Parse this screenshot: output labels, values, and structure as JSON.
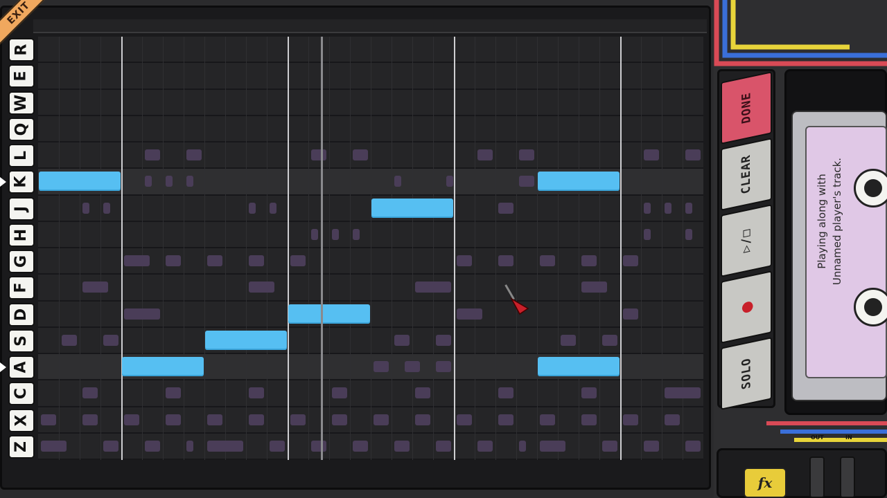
{
  "exit_label": "EXIT",
  "keys": [
    "R",
    "E",
    "W",
    "Q",
    "L",
    "K",
    "J",
    "H",
    "G",
    "F",
    "D",
    "S",
    "A",
    "C",
    "X",
    "Z"
  ],
  "highlighted_rows": [
    5,
    12
  ],
  "grid": {
    "rows": 16,
    "bar_lines": [
      2,
      6,
      10,
      14,
      18
    ],
    "playhead_col": 6.8,
    "notes": [
      {
        "row": 5,
        "start": 0,
        "len": 2
      },
      {
        "row": 12,
        "start": 2,
        "len": 2
      },
      {
        "row": 11,
        "start": 4,
        "len": 2
      },
      {
        "row": 10,
        "start": 6,
        "len": 2
      },
      {
        "row": 6,
        "start": 8,
        "len": 2
      },
      {
        "row": 5,
        "start": 12,
        "len": 2
      },
      {
        "row": 12,
        "start": 12,
        "len": 2
      }
    ],
    "ghost_notes": [
      {
        "row": 4,
        "start": 2.5,
        "len": 0.5
      },
      {
        "row": 4,
        "start": 3.5,
        "len": 0.5
      },
      {
        "row": 4,
        "start": 6.5,
        "len": 0.5
      },
      {
        "row": 4,
        "start": 7.5,
        "len": 0.5
      },
      {
        "row": 4,
        "start": 10.5,
        "len": 0.5
      },
      {
        "row": 4,
        "start": 11.5,
        "len": 0.5
      },
      {
        "row": 4,
        "start": 14.5,
        "len": 0.5
      },
      {
        "row": 4,
        "start": 15.5,
        "len": 0.5
      },
      {
        "row": 5,
        "start": 2.5,
        "len": 0.25
      },
      {
        "row": 5,
        "start": 3,
        "len": 0.25
      },
      {
        "row": 5,
        "start": 3.5,
        "len": 0.25
      },
      {
        "row": 5,
        "start": 8.5,
        "len": 0.25
      },
      {
        "row": 5,
        "start": 9.75,
        "len": 0.25
      },
      {
        "row": 5,
        "start": 11.5,
        "len": 0.5
      },
      {
        "row": 6,
        "start": 1,
        "len": 0.25
      },
      {
        "row": 6,
        "start": 1.5,
        "len": 0.25
      },
      {
        "row": 6,
        "start": 5,
        "len": 0.25
      },
      {
        "row": 6,
        "start": 5.5,
        "len": 0.25
      },
      {
        "row": 6,
        "start": 11,
        "len": 0.5
      },
      {
        "row": 6,
        "start": 14.5,
        "len": 0.25
      },
      {
        "row": 6,
        "start": 15,
        "len": 0.25
      },
      {
        "row": 6,
        "start": 15.5,
        "len": 0.25
      },
      {
        "row": 7,
        "start": 6.5,
        "len": 0.25
      },
      {
        "row": 7,
        "start": 7,
        "len": 0.25
      },
      {
        "row": 7,
        "start": 7.5,
        "len": 0.25
      },
      {
        "row": 7,
        "start": 14.5,
        "len": 0.25
      },
      {
        "row": 7,
        "start": 15.5,
        "len": 0.25
      },
      {
        "row": 8,
        "start": 2,
        "len": 0.75
      },
      {
        "row": 8,
        "start": 3,
        "len": 0.5
      },
      {
        "row": 8,
        "start": 4,
        "len": 0.5
      },
      {
        "row": 8,
        "start": 5,
        "len": 0.5
      },
      {
        "row": 8,
        "start": 6,
        "len": 0.5
      },
      {
        "row": 8,
        "start": 10,
        "len": 0.5
      },
      {
        "row": 8,
        "start": 11,
        "len": 0.5
      },
      {
        "row": 8,
        "start": 12,
        "len": 0.5
      },
      {
        "row": 8,
        "start": 13,
        "len": 0.5
      },
      {
        "row": 8,
        "start": 14,
        "len": 0.5
      },
      {
        "row": 9,
        "start": 1,
        "len": 0.75
      },
      {
        "row": 9,
        "start": 5,
        "len": 0.75
      },
      {
        "row": 9,
        "start": 9,
        "len": 1
      },
      {
        "row": 9,
        "start": 13,
        "len": 0.75
      },
      {
        "row": 10,
        "start": 2,
        "len": 1
      },
      {
        "row": 10,
        "start": 10,
        "len": 0.75
      },
      {
        "row": 10,
        "start": 14,
        "len": 0.5
      },
      {
        "row": 11,
        "start": 0.5,
        "len": 0.5
      },
      {
        "row": 11,
        "start": 1.5,
        "len": 0.5
      },
      {
        "row": 11,
        "start": 8.5,
        "len": 0.5
      },
      {
        "row": 11,
        "start": 9.5,
        "len": 0.5
      },
      {
        "row": 11,
        "start": 12.5,
        "len": 0.5
      },
      {
        "row": 11,
        "start": 13.5,
        "len": 0.5
      },
      {
        "row": 12,
        "start": 8,
        "len": 0.5
      },
      {
        "row": 12,
        "start": 8.75,
        "len": 0.5
      },
      {
        "row": 12,
        "start": 9.5,
        "len": 0.5
      },
      {
        "row": 13,
        "start": 1,
        "len": 0.5
      },
      {
        "row": 13,
        "start": 3,
        "len": 0.5
      },
      {
        "row": 13,
        "start": 5,
        "len": 0.5
      },
      {
        "row": 13,
        "start": 7,
        "len": 0.5
      },
      {
        "row": 13,
        "start": 9,
        "len": 0.5
      },
      {
        "row": 13,
        "start": 11,
        "len": 0.5
      },
      {
        "row": 13,
        "start": 13,
        "len": 0.5
      },
      {
        "row": 13,
        "start": 15,
        "len": 1
      },
      {
        "row": 14,
        "start": 0,
        "len": 0.5
      },
      {
        "row": 14,
        "start": 1,
        "len": 0.5
      },
      {
        "row": 14,
        "start": 2,
        "len": 0.5
      },
      {
        "row": 14,
        "start": 3,
        "len": 0.5
      },
      {
        "row": 14,
        "start": 4,
        "len": 0.5
      },
      {
        "row": 14,
        "start": 5,
        "len": 0.5
      },
      {
        "row": 14,
        "start": 6,
        "len": 0.5
      },
      {
        "row": 14,
        "start": 7,
        "len": 0.5
      },
      {
        "row": 14,
        "start": 8,
        "len": 0.5
      },
      {
        "row": 14,
        "start": 9,
        "len": 0.5
      },
      {
        "row": 14,
        "start": 10,
        "len": 0.5
      },
      {
        "row": 14,
        "start": 11,
        "len": 0.5
      },
      {
        "row": 14,
        "start": 12,
        "len": 0.5
      },
      {
        "row": 14,
        "start": 13,
        "len": 0.5
      },
      {
        "row": 14,
        "start": 14,
        "len": 0.5
      },
      {
        "row": 14,
        "start": 15,
        "len": 0.5
      },
      {
        "row": 15,
        "start": 0,
        "len": 0.75
      },
      {
        "row": 15,
        "start": 1.5,
        "len": 0.5
      },
      {
        "row": 15,
        "start": 2.5,
        "len": 0.5
      },
      {
        "row": 15,
        "start": 3.5,
        "len": 0.25
      },
      {
        "row": 15,
        "start": 4,
        "len": 1
      },
      {
        "row": 15,
        "start": 5.5,
        "len": 0.5
      },
      {
        "row": 15,
        "start": 6.5,
        "len": 0.5
      },
      {
        "row": 15,
        "start": 7.5,
        "len": 0.5
      },
      {
        "row": 15,
        "start": 8.5,
        "len": 0.5
      },
      {
        "row": 15,
        "start": 9.5,
        "len": 0.5
      },
      {
        "row": 15,
        "start": 10.5,
        "len": 0.5
      },
      {
        "row": 15,
        "start": 11.5,
        "len": 0.25
      },
      {
        "row": 15,
        "start": 12,
        "len": 0.75
      },
      {
        "row": 15,
        "start": 13.5,
        "len": 0.5
      },
      {
        "row": 15,
        "start": 14.5,
        "len": 0.5
      },
      {
        "row": 15,
        "start": 15.5,
        "len": 0.5
      }
    ]
  },
  "buttons": {
    "done": "DONE",
    "clear": "CLEAR",
    "play_pause": "▷/□",
    "record": "●",
    "solo": "SOLO"
  },
  "cassette": {
    "label_line1": "Playing along with",
    "label_line2": "Unnamed player's track."
  },
  "outputs": {
    "out": "OUT",
    "in": "IN"
  },
  "fx_label": "fx",
  "colors": {
    "note": "#56bff2",
    "ghost": "#4a3d58",
    "done_button": "#d9546a",
    "wire_red": "#d94a56",
    "wire_blue": "#3a6fd9",
    "wire_yellow": "#e8d43a"
  }
}
